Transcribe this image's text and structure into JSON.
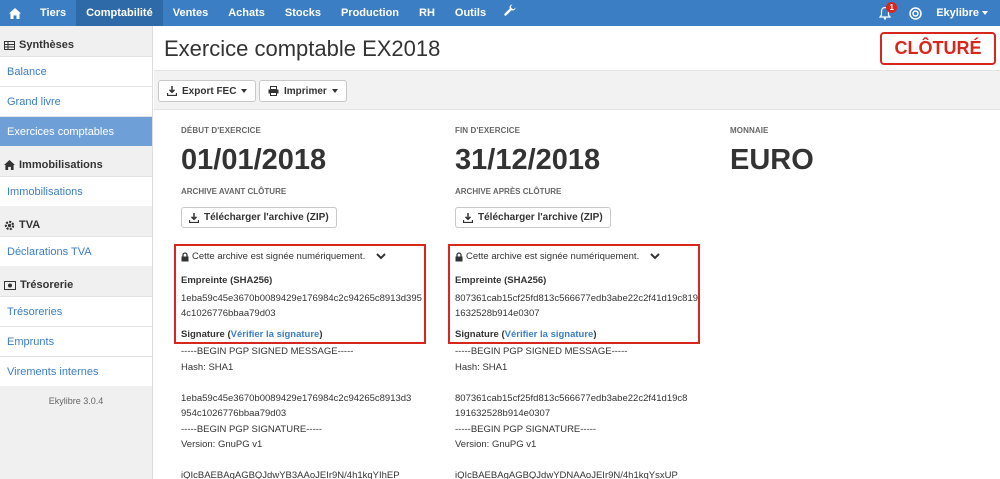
{
  "topnav": {
    "items": [
      {
        "label": "Tiers"
      },
      {
        "label": "Comptabilité",
        "active": true
      },
      {
        "label": "Ventes"
      },
      {
        "label": "Achats"
      },
      {
        "label": "Stocks"
      },
      {
        "label": "Production"
      },
      {
        "label": "RH"
      },
      {
        "label": "Outils"
      }
    ],
    "notification_count": "1",
    "user": "Ekylibre",
    "accent_color": "#3c7ec4"
  },
  "sidebar": {
    "sections": {
      "syntheses": "Synthèses",
      "immobilisations": "Immobilisations",
      "tva": "TVA",
      "tresorerie": "Trésorerie"
    },
    "items": {
      "balance": "Balance",
      "grand_livre": "Grand livre",
      "exercices": "Exercices comptables",
      "immobilisations": "Immobilisations",
      "declarations_tva": "Déclarations TVA",
      "tresoreries": "Trésoreries",
      "emprunts": "Emprunts",
      "virements": "Virements internes"
    },
    "version": "Ekylibre 3.0.4"
  },
  "page": {
    "title": "Exercice comptable EX2018",
    "status": "CLÔTURÉ",
    "status_color": "#d9261c"
  },
  "toolbar": {
    "export": "Export FEC",
    "print": "Imprimer"
  },
  "start": {
    "label": "DÉBUT D'EXERCICE",
    "value": "01/01/2018",
    "archive_label": "ARCHIVE AVANT CLÔTURE",
    "download": "Télécharger l'archive (ZIP)",
    "signed_text": "Cette archive est signée numériquement.",
    "hash_label": "Empreinte (SHA256)",
    "hash": "1eba59c45e3670b0089429e176984c2c94265c8913d3954c1026776bbaa79d03",
    "signature_label": "Signature",
    "verify_link": "Vérifier la signature",
    "pgp": "-----BEGIN PGP SIGNED MESSAGE-----\nHash: SHA1\n\n1eba59c45e3670b0089429e176984c2c94265c8913d3\n954c1026776bbaa79d03\n-----BEGIN PGP SIGNATURE-----\nVersion: GnuPG v1\n\niQIcBAEBAgAGBQJdwYB3AAoJEIr9N/4h1kqYIhEP"
  },
  "end": {
    "label": "FIN D'EXERCICE",
    "value": "31/12/2018",
    "archive_label": "ARCHIVE APRÈS CLÔTURE",
    "download": "Télécharger l'archive (ZIP)",
    "signed_text": "Cette archive est signée numériquement.",
    "hash_label": "Empreinte (SHA256)",
    "hash": "807361cab15cf25fd813c566677edb3abe22c2f41d19c8191632528b914e0307",
    "signature_label": "Signature",
    "verify_link": "Vérifier la signature",
    "pgp": "-----BEGIN PGP SIGNED MESSAGE-----\nHash: SHA1\n\n807361cab15cf25fd813c566677edb3abe22c2f41d19c8\n191632528b914e0307\n-----BEGIN PGP SIGNATURE-----\nVersion: GnuPG v1\n\niQIcBAEBAgAGBQJdwYDNAAoJEIr9N/4h1kqYsxUP"
  },
  "currency": {
    "label": "MONNAIE",
    "value": "EURO"
  }
}
